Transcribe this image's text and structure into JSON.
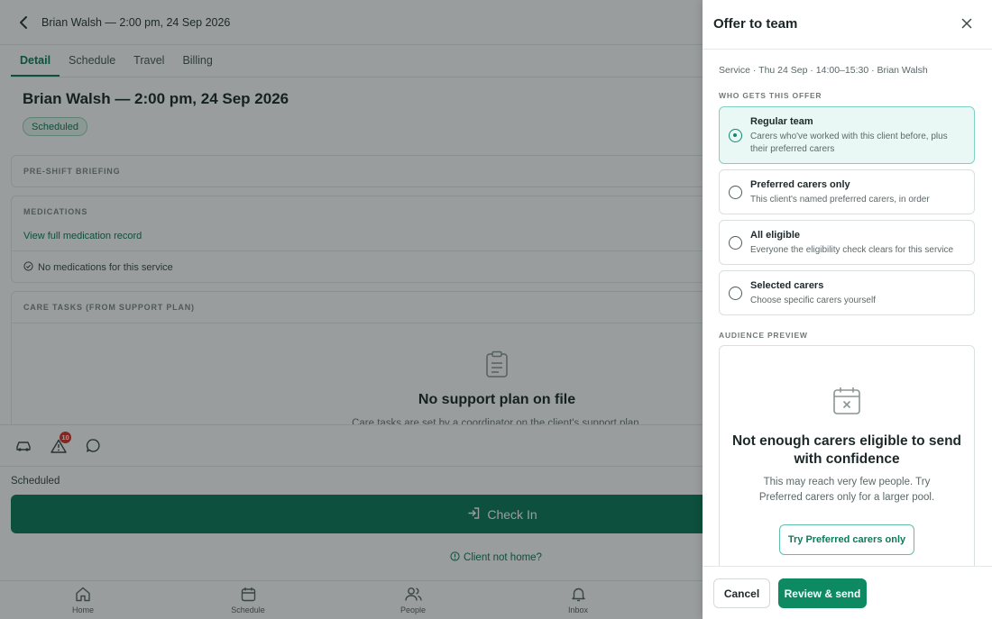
{
  "colors": {
    "accent": "#0e7a5a",
    "primary_button": "#0e8a62",
    "selected_option_bg": "#eaf8f5",
    "badge_alert": "#d9352c"
  },
  "header": {
    "back_icon": "chevron-left-icon",
    "title": "Brian Walsh — 2:00 pm, 24 Sep 2026"
  },
  "tabs": [
    {
      "label": "Detail",
      "active": true
    },
    {
      "label": "Schedule",
      "active": false
    },
    {
      "label": "Travel",
      "active": false
    },
    {
      "label": "Billing",
      "active": false
    }
  ],
  "main": {
    "title": "Brian Walsh — 2:00 pm, 24 Sep 2026",
    "status_badge": "Scheduled",
    "briefing_label": "PRE-SHIFT BRIEFING",
    "medications": {
      "label": "MEDICATIONS",
      "link": "View full medication record",
      "empty": "No medications for this service"
    },
    "care_tasks": {
      "label": "CARE TASKS (FROM SUPPORT PLAN)",
      "empty_title": "No support plan on file",
      "empty_sub": "Care tasks are set by a coordinator on the client's support plan."
    }
  },
  "action_bar": {
    "icons": [
      "car-icon",
      "warning-icon",
      "chat-icon"
    ],
    "warning_count": "10"
  },
  "status_text": "Scheduled",
  "check_in": {
    "label": "Check In",
    "icon": "sign-in-icon"
  },
  "client_not_home": "Client not home?",
  "bottom_nav": [
    {
      "label": "Home",
      "icon": "home-icon"
    },
    {
      "label": "Schedule",
      "icon": "calendar-icon"
    },
    {
      "label": "People",
      "icon": "people-icon"
    },
    {
      "label": "Inbox",
      "icon": "bell-icon"
    }
  ],
  "drawer": {
    "title": "Offer to team",
    "close_icon": "close-icon",
    "service_line": "Service · Thu 24 Sep · 14:00–15:30 · Brian Walsh",
    "who_label": "WHO GETS THIS OFFER",
    "options": [
      {
        "title": "Regular team",
        "desc": "Carers who've worked with this client before, plus their preferred carers",
        "selected": true
      },
      {
        "title": "Preferred carers only",
        "desc": "This client's named preferred carers, in order",
        "selected": false
      },
      {
        "title": "All eligible",
        "desc": "Everyone the eligibility check clears for this service",
        "selected": false
      },
      {
        "title": "Selected carers",
        "desc": "Choose specific carers yourself",
        "selected": false
      }
    ],
    "preview_label": "AUDIENCE PREVIEW",
    "preview": {
      "icon": "calendar-x-icon",
      "title": "Not enough carers eligible to send with confidence",
      "sub": "This may reach very few people. Try Preferred carers only for a larger pool.",
      "button": "Try Preferred carers only"
    },
    "cancel": "Cancel",
    "send": "Review & send"
  }
}
